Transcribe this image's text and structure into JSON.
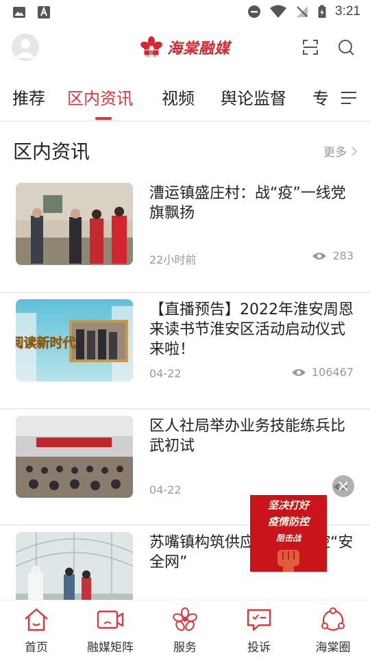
{
  "status": {
    "time": "3:21"
  },
  "header": {
    "logo_text": "海棠融媒",
    "logo_seal": "区"
  },
  "tabs": [
    "推荐",
    "区内资讯",
    "视频",
    "舆论监督",
    "专"
  ],
  "section": {
    "title": "区内资讯",
    "more": "更多"
  },
  "news": [
    {
      "title": "漕运镇盛庄村：战“疫”一线党旗飘扬",
      "time": "22小时前",
      "views": "283"
    },
    {
      "title": "【直播预告】2022年淮安周恩来读书节淮安区活动启动仪式来啦！",
      "time": "04-22",
      "views": "106467",
      "thumb_text": "阅读新时代"
    },
    {
      "title": "区人社局举办业务技能练兵比武初试",
      "time": "04-22",
      "views": ""
    },
    {
      "title": "苏嘴镇构筑供应链疫情防控“安全网”",
      "time": "",
      "views": ""
    }
  ],
  "ad": {
    "line1": "坚决打好",
    "line2": "疫情防控",
    "line3": "阻击战"
  },
  "bottom_nav": [
    "首页",
    "融媒矩阵",
    "服务",
    "投诉",
    "海棠圈"
  ],
  "colors": {
    "accent": "#e0343b",
    "brand": "#d8262e"
  }
}
